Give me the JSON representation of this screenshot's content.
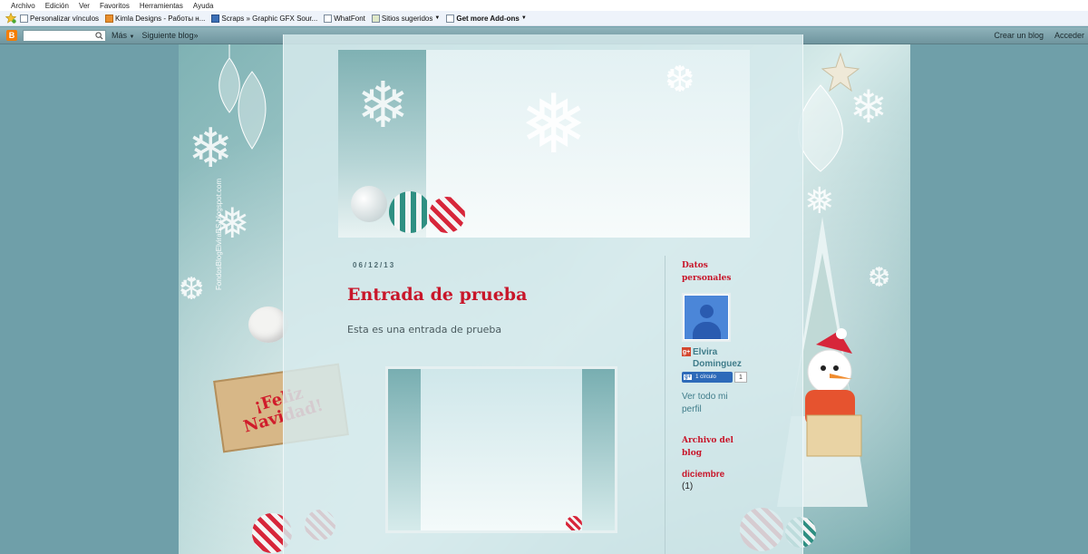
{
  "menubar": {
    "items": [
      "Archivo",
      "Edición",
      "Ver",
      "Favoritos",
      "Herramientas",
      "Ayuda"
    ]
  },
  "favorites": {
    "items": [
      {
        "label": "Personalizar vínculos",
        "icon": "page-icon"
      },
      {
        "label": "Kimla Designs - Работы н...",
        "icon": "page-icon"
      },
      {
        "label": "Scraps » Graphic GFX Sour...",
        "icon": "page-icon"
      },
      {
        "label": "WhatFont",
        "icon": "page-icon"
      },
      {
        "label": "Sitios sugeridos",
        "icon": "page-icon",
        "dropdown": true
      },
      {
        "label": "Get more Add-ons",
        "icon": "page-icon",
        "dropdown": true
      }
    ]
  },
  "navbar": {
    "search_value": "",
    "more_label": "Más",
    "next_blog_label": "Siguiente blog»",
    "create_blog_label": "Crear un blog",
    "sign_in_label": "Acceder",
    "brand_color": "#f57d00"
  },
  "post": {
    "date": "06/12/13",
    "title": "Entrada de prueba",
    "body": "Esta es una entrada de prueba"
  },
  "sidebar": {
    "profile_title": "Datos personales",
    "profile_name": "Elvira Dominguez",
    "circles_label": "1 círculo",
    "circles_count": "1",
    "view_profile_label": "Ver todo mi perfil",
    "archive_title": "Archivo del blog",
    "archive_month": "diciembre",
    "archive_count": "(1)"
  },
  "decor": {
    "sign_text": "¡Feliz Navidad!",
    "vertical_url": "FondosBlogElviraBS.blogspot.com"
  },
  "colors": {
    "accent_red": "#c8162a",
    "link_teal": "#3f7c8a",
    "page_bg": "#6f9fa9"
  }
}
